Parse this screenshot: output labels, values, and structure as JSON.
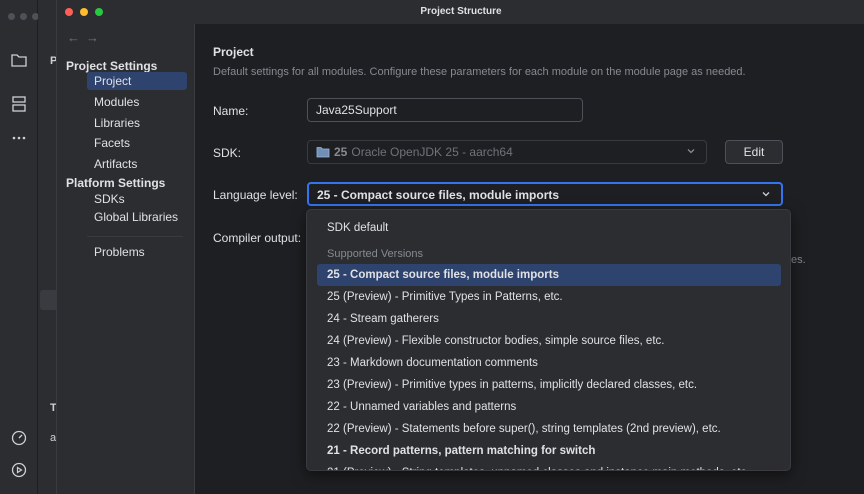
{
  "window": {
    "title": "Project Structure"
  },
  "ide": {
    "pane_letter_top": "P",
    "pane_letter_mid": "T",
    "pane_letter_low": "a"
  },
  "sidebar": {
    "project_settings_header": "Project Settings",
    "project_items": [
      "Project",
      "Modules",
      "Libraries",
      "Facets",
      "Artifacts"
    ],
    "platform_settings_header": "Platform Settings",
    "platform_items": [
      "SDKs",
      "Global Libraries"
    ],
    "problems": "Problems",
    "selected_index": 0
  },
  "main": {
    "heading": "Project",
    "subheading": "Default settings for all modules. Configure these parameters for each module on the module page as needed.",
    "name_label": "Name:",
    "name_value": "Java25Support",
    "sdk_label": "SDK:",
    "sdk_version": "25",
    "sdk_value": "Oracle OpenJDK 25 - aarch64",
    "edit_button": "Edit",
    "language_level_label": "Language level:",
    "language_level_value": "25 - Compact source files, module imports",
    "compiler_output_label": "Compiler output:",
    "truncated_tail": "es."
  },
  "dropdown": {
    "sdk_default": "SDK default",
    "group_label": "Supported Versions",
    "options": [
      "25 - Compact source files, module imports",
      "25 (Preview) - Primitive Types in Patterns, etc.",
      "24 - Stream gatherers",
      "24 (Preview) - Flexible constructor bodies, simple source files, etc.",
      "23 - Markdown documentation comments",
      "23 (Preview) - Primitive types in patterns, implicitly declared classes, etc.",
      "22 - Unnamed variables and patterns",
      "22 (Preview) - Statements before super(), string templates (2nd preview), etc.",
      "21 - Record patterns, pattern matching for switch",
      "21 (Preview) - String templates, unnamed classes and instance main methods, etc."
    ],
    "selected_index": 0,
    "bold_index": 8
  },
  "colors": {
    "accent": "#3574f0",
    "selection": "#2e436e",
    "traffic_close": "#ff5f57",
    "traffic_min": "#febc2e",
    "traffic_max": "#28c840"
  },
  "icons": [
    "folder-icon",
    "structure-icon",
    "more-icon",
    "dashboard-icon",
    "run-icon",
    "chevron-down-icon",
    "sdk-folder-icon",
    "back-arrow-icon",
    "forward-arrow-icon"
  ]
}
